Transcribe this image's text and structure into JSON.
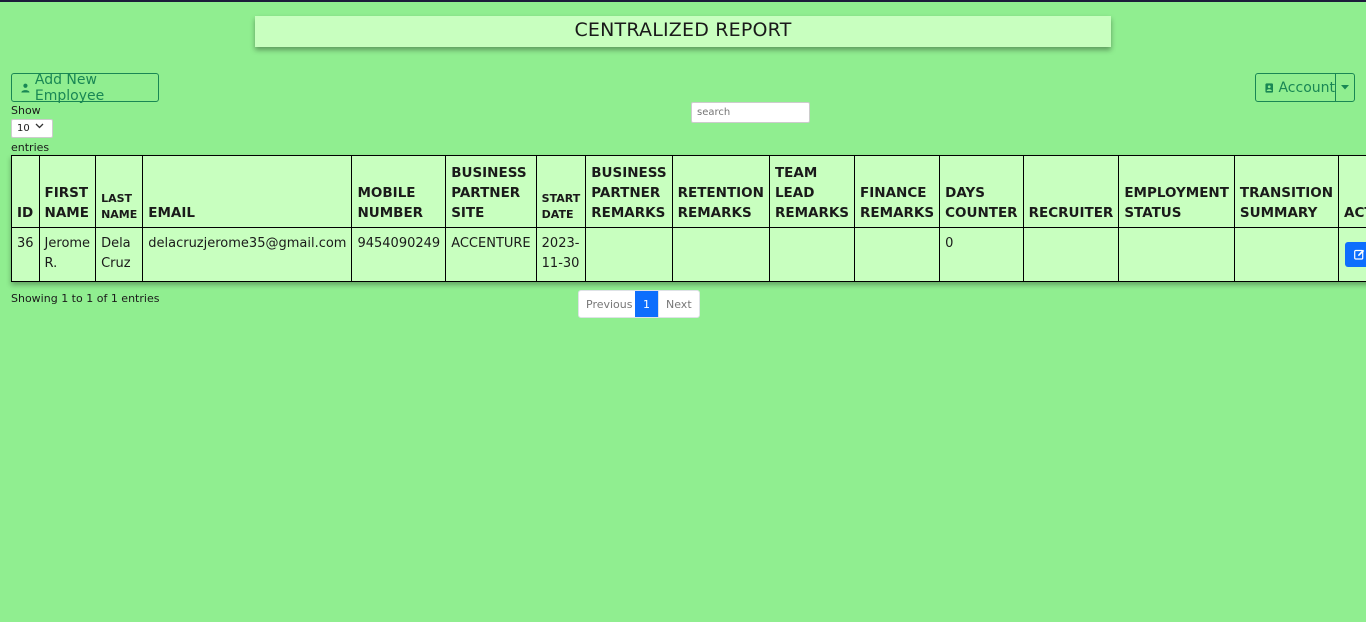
{
  "title": "CENTRALIZED REPORT",
  "add_button": "Add New Employee",
  "account_button": "Account",
  "show_label": "Show",
  "entries_value": "10",
  "entries_label": "entries",
  "search_placeholder": "search",
  "table": {
    "headers": [
      "ID",
      "FIRST NAME",
      "LAST NAME",
      "EMAIL",
      "MOBILE NUMBER",
      "BUSINESS PARTNER SITE",
      "START DATE",
      "BUSINESS PARTNER REMARKS",
      "RETENTION REMARKS",
      "TEAM LEAD REMARKS",
      "FINANCE REMARKS",
      "DAYS COUNTER",
      "RECRUITER",
      "EMPLOYMENT STATUS",
      "TRANSITION SUMMARY",
      "ACTION"
    ],
    "rows": [
      [
        "36",
        "Jerome R.",
        "Dela Cruz",
        "delacruzjerome35@gmail.com",
        "9454090249",
        "ACCENTURE",
        "2023-11-30",
        "",
        "",
        "",
        "",
        "0",
        "",
        "",
        "",
        ""
      ]
    ]
  },
  "info_text": "Showing 1 to 1 of 1 entries",
  "pagination": {
    "previous": "Previous",
    "current": "1",
    "next": "Next"
  },
  "colors": {
    "background": "#90ee90",
    "panel": "#c8ffbf",
    "primary": "#0d6efd",
    "danger": "#dc3545",
    "success": "#198754"
  },
  "icons": [
    "user-icon",
    "account-icon",
    "caret-down-icon",
    "chevron-down-icon",
    "edit-icon",
    "trash-icon"
  ]
}
